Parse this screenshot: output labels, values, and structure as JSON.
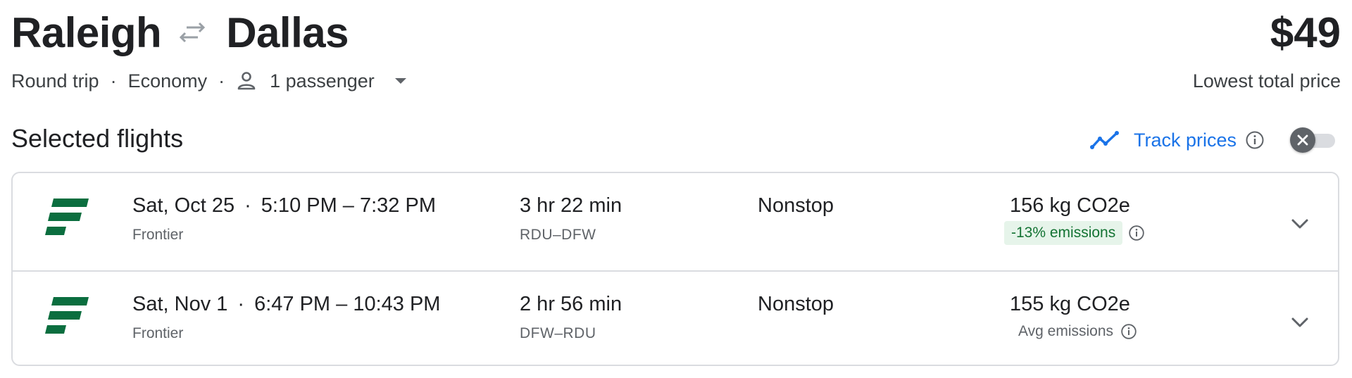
{
  "header": {
    "origin": "Raleigh",
    "destination": "Dallas",
    "price": "$49",
    "price_caption": "Lowest total price",
    "trip_type": "Round trip",
    "cabin": "Economy",
    "passengers": "1 passenger",
    "separator": "·"
  },
  "section": {
    "title": "Selected flights",
    "track_label": "Track prices",
    "track_enabled": false
  },
  "flights": [
    {
      "date": "Sat, Oct 25",
      "time_range": "5:10 PM – 7:32 PM",
      "airline": "Frontier",
      "duration": "3 hr 22 min",
      "route": "RDU–DFW",
      "stops": "Nonstop",
      "co2": "156 kg CO2e",
      "emissions_label": "-13% emissions"
    },
    {
      "date": "Sat, Nov 1",
      "time_range": "6:47 PM – 10:43 PM",
      "airline": "Frontier",
      "duration": "2 hr 56 min",
      "route": "DFW–RDU",
      "stops": "Nonstop",
      "co2": "155 kg CO2e",
      "emissions_label": "Avg emissions"
    }
  ],
  "icons": {
    "swap": "swap-arrows-icon",
    "passenger": "person-icon",
    "dropdown": "caret-down-icon",
    "trend": "trend-line-icon",
    "info": "info-icon",
    "close": "close-icon",
    "expand": "chevron-down-icon",
    "airline_logo": "frontier-logo"
  },
  "colors": {
    "accent": "#1a73e8",
    "airline_green": "#0b6e3f",
    "low_emissions_bg": "#e6f4ea",
    "low_emissions_text": "#137333"
  }
}
